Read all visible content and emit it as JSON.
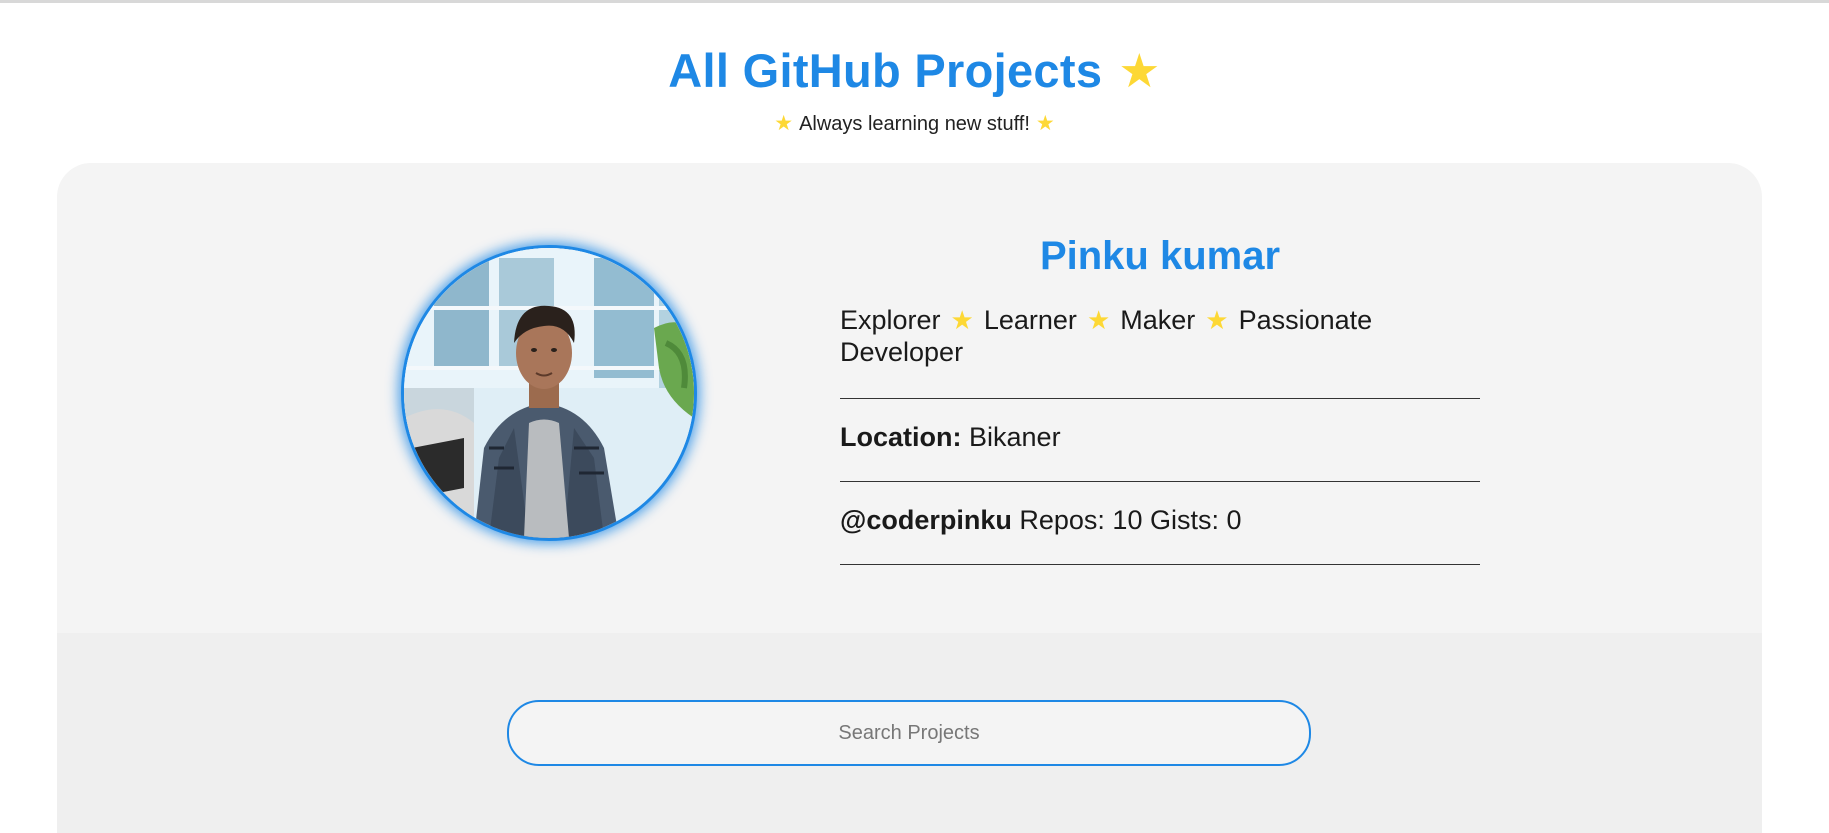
{
  "header": {
    "title": "All GitHub Projects",
    "title_icon": "star-icon",
    "subtitle": "Always learning new stuff!",
    "subtitle_icons": [
      "star-icon",
      "star-icon"
    ]
  },
  "profile": {
    "name": "Pinku kumar",
    "bio": {
      "words": [
        "Explorer",
        "Learner",
        "Maker",
        "Passionate Developer"
      ],
      "separator_icon": "star-icon"
    },
    "location_label": "Location:",
    "location_value": "Bikaner",
    "username": "@coderpinku",
    "repos_text": "Repos: 10",
    "gists_text": "Gists: 0",
    "avatar_icon": "profile-photo"
  },
  "search": {
    "placeholder": "Search Projects",
    "value": ""
  },
  "colors": {
    "accent": "#1e88e5",
    "star": "#fdd835",
    "card_bg": "#f4f4f4",
    "card_lower_bg": "#efefef"
  }
}
